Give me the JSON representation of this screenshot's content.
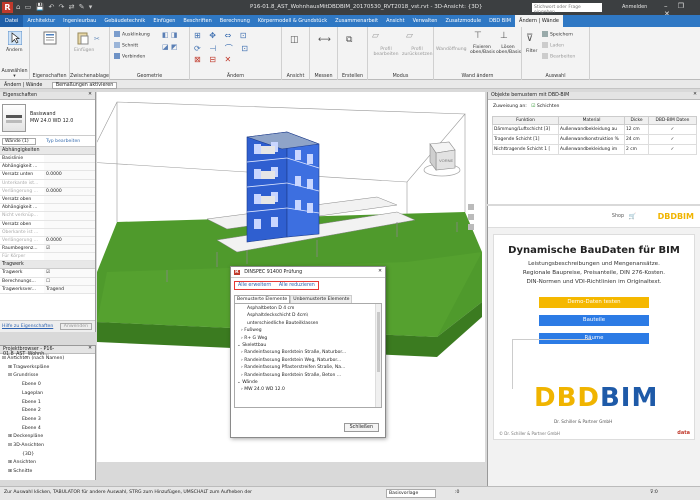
{
  "titlebar": {
    "logo": "R",
    "quick_access": "⌂ ▭ 💾 ↶ ↷ ⇄ ✎ ▾",
    "title": "P16-01.8_AST_WohnhausMitDBDBIM_20170530_RVT2018_vst.rvt - 3D-Ansicht: {3D}",
    "search_placeholder": "Stichwort oder Frage eingeben",
    "login": "Anmelden",
    "window_controls": "– ❐ ✕"
  },
  "tabs": [
    "Datei",
    "Architektur",
    "Ingenieurbau",
    "Gebäudetechnik",
    "Einfügen",
    "Beschriften",
    "Berechnung",
    "Körpermodell & Grundstück",
    "Zusammenarbeit",
    "Ansicht",
    "Verwalten",
    "Zusatzmodule",
    "DBD BIM",
    "Ändern | Wände"
  ],
  "ribbon": {
    "select": {
      "label": "Auswählen ▾",
      "modify": "Ändern"
    },
    "properties": {
      "label": "Eigenschaften"
    },
    "clipboard": {
      "label": "Zwischenablage",
      "paste": "Einfügen"
    },
    "geometry": {
      "label": "Geometrie",
      "items": [
        "Ausklinkung",
        "Schnitt",
        "Verbinden"
      ]
    },
    "modify": {
      "label": "Ändern"
    },
    "view": {
      "label": "Ansicht"
    },
    "measure": {
      "label": "Messen"
    },
    "create": {
      "label": "Erstellen"
    },
    "mode": {
      "label": "Modus",
      "items": [
        "Profil bearbeiten",
        "Profil zurücksetzen"
      ]
    },
    "wall": {
      "label": "Wand ändern",
      "items": [
        "Wandöffnung",
        "Fixieren oben/Basis",
        "Lösen oben/Basis"
      ]
    },
    "filter": {
      "label": "Filter"
    },
    "selection": {
      "label": "Auswahl",
      "items": [
        "Speichern",
        "Laden",
        "Bearbeiten"
      ]
    }
  },
  "ctxbar": {
    "context": "Ändern | Wände",
    "chip": "Bemaßungen aktivieren"
  },
  "properties": {
    "title": "Eigenschaften",
    "type_family": "Basiswand",
    "type_name": "MW 24.0 WD 12.0",
    "filter": "Wände (1)",
    "edit_type": "Typ bearbeiten",
    "section_constraints": "Abhängigkeiten",
    "rows": [
      {
        "k": "Basislinie",
        "v": ""
      },
      {
        "k": "Abhängigkeit ...",
        "v": ""
      },
      {
        "k": "Versatz unten",
        "v": "0.0000"
      },
      {
        "k": "Unterkante ist...",
        "v": ""
      },
      {
        "k": "Verlängerung ...",
        "v": "0.0000"
      },
      {
        "k": "Versatz oben",
        "v": ""
      },
      {
        "k": "Abhängigkeit ...",
        "v": ""
      },
      {
        "k": "Nicht verknüp...",
        "v": ""
      },
      {
        "k": "Versatz oben",
        "v": ""
      },
      {
        "k": "Oberkante ist ...",
        "v": ""
      },
      {
        "k": "Verlängerung ...",
        "v": "0.0000"
      },
      {
        "k": "Raumbegrenz...",
        "v": ""
      },
      {
        "k": "Für Körper",
        "v": ""
      }
    ],
    "section_structure": "Tragwerk",
    "rows2": [
      {
        "k": "Tragwerk",
        "v": ""
      },
      {
        "k": "Berechnungs...",
        "v": ""
      },
      {
        "k": "Tragwerksver...",
        "v": "Tragend"
      }
    ],
    "help_link": "Hilfe zu Eigenschaften",
    "apply": "Anwenden"
  },
  "browser": {
    "title": "Projektbrowser - P16-01.8_AST_Wohnh...",
    "items": [
      {
        "text": "⊟ Ansichten (nach Namen)",
        "indent": 0
      },
      {
        "text": "⊞ Tragwerkspläne",
        "indent": 1
      },
      {
        "text": "⊟ Grundrisse",
        "indent": 1
      },
      {
        "text": "Ebene 0",
        "indent": 3
      },
      {
        "text": "Lageplan",
        "indent": 3
      },
      {
        "text": "Ebene 1",
        "indent": 3
      },
      {
        "text": "Ebene 2",
        "indent": 3
      },
      {
        "text": "Ebene 3",
        "indent": 3
      },
      {
        "text": "Ebene 4",
        "indent": 3
      },
      {
        "text": "⊞ Deckenpläne",
        "indent": 1
      },
      {
        "text": "⊟ 3D-Ansichten",
        "indent": 1
      },
      {
        "text": "{3D}",
        "indent": 3
      },
      {
        "text": "⊞ Ansichten",
        "indent": 1
      },
      {
        "text": "⊞ Schnitte",
        "indent": 1
      }
    ]
  },
  "dbd_panel": {
    "title": "Objekte bemustern mit DBD-BIM",
    "assign": "Zuweisung an:",
    "layers": "Schichten",
    "headers": [
      "Funktion",
      "Material",
      "Dicke",
      "DBD-BIM Daten"
    ],
    "rows": [
      [
        "Dämmung/Luftschicht [3]",
        "Außenwandbekleidung au",
        "12 cm",
        "✓"
      ],
      [
        "Tragende Schicht [1]",
        "Außenwandkonstruktion %",
        "24 cm",
        "✓"
      ],
      [
        "Nichttragende Schicht 1 [",
        "Außenwandbekleidung im",
        "2 cm",
        "✓"
      ]
    ]
  },
  "ad": {
    "shop": "Shop",
    "logo_small": "DBDBIM",
    "headline": "Dynamische BauDaten für BIM",
    "line1": "Leistungsbeschreibungen und Mengenansätze.",
    "line2": "Regionale Baupreise, Preisanteile, DIN 276-Kosten.",
    "line3": "DIN-Normen und VDI-Richtlinien im Originaltext.",
    "btn_demo": "Demo-Daten testen",
    "btn_parts": "Bauteile",
    "btn_rooms": "Räume",
    "logo_dbd": "DBD",
    "logo_bim": "BIM",
    "copyright": "© Dr. Schiller & Partner GmbH",
    "brand_mark": "Dr. Schiller & Partner GmbH",
    "corner_brand": "data"
  },
  "dialog": {
    "title": "DINSPEC 91400 Prüfung",
    "link_expand": "Alle erweitern",
    "link_reduce": "Alle reduzieren",
    "tab1": "Bemusterte Elemente",
    "tab2": "Unbemusterte Elemente",
    "tree": [
      {
        "text": "Asphaltbeton D 4 cm",
        "indent": 2
      },
      {
        "text": "Asphaltdeckschicht D 4cm\\",
        "indent": 2
      },
      {
        "text": "unterschiedliche Bauteilklassen",
        "indent": 2
      },
      {
        "text": "› Fußweg",
        "indent": 1
      },
      {
        "text": "› R+ G Weg",
        "indent": 1
      },
      {
        "text": "⌄ Skelettbau",
        "indent": 0
      },
      {
        "text": "› Randeinfassung Bordstein Straße, Naturbor...",
        "indent": 1
      },
      {
        "text": "› Randeinfassung Bordstein Weg, Naturbor...",
        "indent": 1
      },
      {
        "text": "› Randeinfassung Pflasterstreifen Straße, Na...",
        "indent": 1
      },
      {
        "text": "› Randeinfassung Bordstein Straße, Beton ...",
        "indent": 1
      },
      {
        "text": "⌄ Wände",
        "indent": 0
      },
      {
        "text": "› MW 24.0 WD 12.0",
        "indent": 1
      }
    ],
    "close": "Schließen"
  },
  "viewcube": {
    "label": "VORNE"
  },
  "status": {
    "text": "Zur Auswahl klicken, TABULATOR für andere Auswahl, STRG zum Hinzufügen, UMSCHALT zum Aufheben der",
    "scale_field": "Basisvorlage",
    "count": ":0",
    "filter_count": "⊽:0"
  }
}
